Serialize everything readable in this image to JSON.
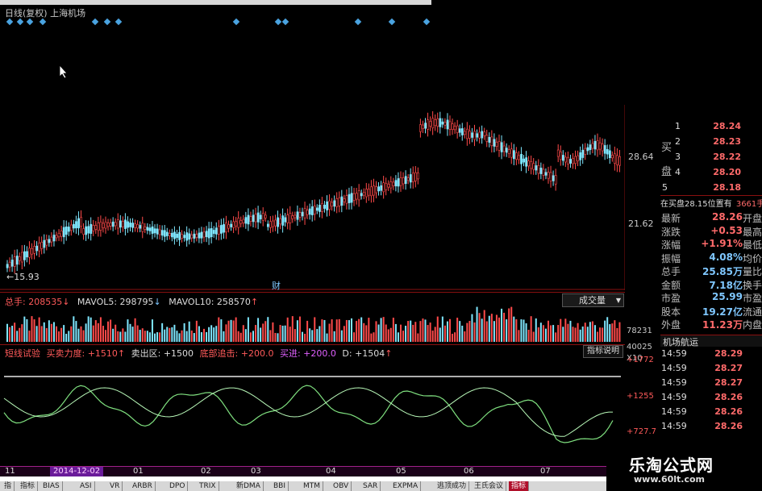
{
  "title": "日线(复权)  上海机场",
  "price_axis": [
    "28.64",
    "21.62"
  ],
  "low_marker": "←15.93",
  "fin_marker": "财",
  "volume": {
    "label_main": "总手: 208535",
    "label_ma5": "MAVOL5: 298795",
    "label_ma10": "MAVOL10: 258570",
    "dropdown": "成交量",
    "axis": [
      "78231",
      "40025",
      "X10"
    ]
  },
  "indicator": {
    "name": "短线试验",
    "buy_label": "买卖力度: +1510",
    "sell_label": "卖出区: +1500",
    "bottom_label": "底部追击: +200.0",
    "buy2_label": "买进: +200.0",
    "d_label": "D: +1504",
    "help_button": "指标说明",
    "axis": [
      "+1772",
      "+1255",
      "+727.7"
    ]
  },
  "order_book": {
    "sell_side": "买",
    "buy_side": "盘",
    "levels": [
      {
        "lvl": "1",
        "price": "28.24"
      },
      {
        "lvl": "2",
        "price": "28.23"
      },
      {
        "lvl": "3",
        "price": "28.22"
      },
      {
        "lvl": "4",
        "price": "28.20"
      },
      {
        "lvl": "5",
        "price": "28.18"
      }
    ],
    "inplate": "在买盘28.15位置有",
    "inplate_qty": "3661手"
  },
  "stats": [
    {
      "k": "最新",
      "v": "28.26",
      "k2": "开盘",
      "blue": false
    },
    {
      "k": "涨跌",
      "v": "+0.53",
      "k2": "最高",
      "blue": false
    },
    {
      "k": "涨幅",
      "v": "+1.91%",
      "k2": "最低",
      "blue": false
    },
    {
      "k": "振幅",
      "v": "4.08%",
      "k2": "均价",
      "blue": true
    },
    {
      "k": "总手",
      "v": "25.85万",
      "k2": "量比",
      "blue": true
    },
    {
      "k": "金额",
      "v": "7.18亿",
      "k2": "换手",
      "blue": true
    },
    {
      "k": "市盈",
      "v": "25.99",
      "k2": "市盈",
      "blue": true
    },
    {
      "k": "股本",
      "v": "19.27亿",
      "k2": "流通",
      "blue": true
    },
    {
      "k": "外盘",
      "v": "11.23万",
      "k2": "内盘",
      "blue": false
    }
  ],
  "ticks_title": "机场航运",
  "ticks": [
    {
      "t": "14:59",
      "p": "28.29"
    },
    {
      "t": "14:59",
      "p": "28.27"
    },
    {
      "t": "14:59",
      "p": "28.27"
    },
    {
      "t": "14:59",
      "p": "28.26"
    },
    {
      "t": "14:59",
      "p": "28.26"
    },
    {
      "t": "14:59",
      "p": "28.26"
    }
  ],
  "timeline": {
    "current": "2014-12-02",
    "labels": [
      "11",
      "01",
      "02",
      "03",
      "04",
      "05",
      "06",
      "07"
    ]
  },
  "tabs": [
    "指",
    "指标",
    "BIAS",
    "ASI",
    "VR",
    "ARBR",
    "DPO",
    "TRIX",
    "新DMA",
    "BBI",
    "MTM",
    "OBV",
    "SAR",
    "EXPMA",
    "逃顶成功",
    "王氏会议",
    "指标"
  ],
  "watermark": {
    "line1": "乐淘公式网",
    "line2": "www.60lt.com"
  },
  "colors": {
    "up": "#ff4a4a",
    "down": "#7fe7ff",
    "accent": "#a0208a"
  }
}
